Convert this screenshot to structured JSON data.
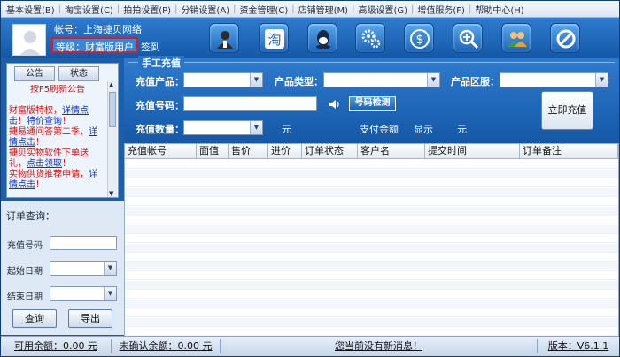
{
  "menu": [
    "基本设置(B)",
    "淘宝设置(C)",
    "拍拍设置(P)",
    "分销设置(A)",
    "资金管理(C)",
    "店铺管理(M)",
    "高级设置(G)",
    "增值服务(F)",
    "帮助中心(H)"
  ],
  "account": {
    "label": "帐号：上海捷贝网络",
    "level": "等级：财富版用户",
    "signin": "签到"
  },
  "toolbar_icons": [
    "customer-service-icon",
    "taobao-icon",
    "qq-icon",
    "settings-gears-icon",
    "money-icon",
    "search-zoom-icon",
    "users-icon",
    "disable-icon"
  ],
  "notice": {
    "tabs": [
      "公告",
      "状态"
    ],
    "lines": [
      {
        "text": "按F5刷新公告",
        "cls": "red",
        "center": true
      },
      {
        "text": "",
        "cls": ""
      },
      {
        "parts": [
          {
            "t": "财富版特权，",
            "c": "red"
          },
          {
            "t": "详情点",
            "c": "blue"
          }
        ]
      },
      {
        "parts": [
          {
            "t": "击",
            "c": "blue"
          },
          {
            "t": "！",
            "c": "red"
          },
          {
            "t": "特价查询",
            "c": "blue"
          },
          {
            "t": "！",
            "c": "red"
          }
        ]
      },
      {
        "parts": [
          {
            "t": "捷易通问答第二季，",
            "c": "red"
          },
          {
            "t": "详",
            "c": "blue"
          }
        ]
      },
      {
        "parts": [
          {
            "t": "情点击",
            "c": "blue"
          },
          {
            "t": "！",
            "c": "red"
          }
        ]
      },
      {
        "parts": [
          {
            "t": "捷贝实物软件下单送",
            "c": "red"
          }
        ]
      },
      {
        "parts": [
          {
            "t": "礼，",
            "c": "red"
          },
          {
            "t": "点击领取",
            "c": "blue"
          },
          {
            "t": "！",
            "c": "red"
          }
        ]
      },
      {
        "parts": [
          {
            "t": "实物供货推荐申请，",
            "c": "red"
          },
          {
            "t": "详",
            "c": "blue"
          }
        ]
      },
      {
        "parts": [
          {
            "t": "情点击",
            "c": "blue"
          },
          {
            "t": "！",
            "c": "red"
          }
        ]
      }
    ]
  },
  "query": {
    "title": "订单查询：",
    "phone_label": "充值号码",
    "start_label": "起始日期",
    "end_label": "结束日期",
    "search_btn": "查询",
    "export_btn": "导出"
  },
  "charge": {
    "section_title": "手工充值",
    "product_label": "充值产品：",
    "type_label": "产品类型：",
    "region_label": "产品区服：",
    "phone_label": "充值号码：",
    "detect_btn": "号码检测",
    "qty_label": "充值数量：",
    "yuan1": "元",
    "pay_label": "支付金额",
    "show_label": "显示",
    "yuan2": "元",
    "charge_btn": "立即充值"
  },
  "table": {
    "columns": [
      "充值帐号",
      "面值",
      "售价",
      "进价",
      "订单状态",
      "客户名",
      "提交时间",
      "订单备注"
    ]
  },
  "status": {
    "available": "可用余额：0.00 元",
    "unconfirmed": "未确认余额：0.00 元",
    "message": "您当前没有新消息！",
    "version": "版本：V6.1.1"
  }
}
